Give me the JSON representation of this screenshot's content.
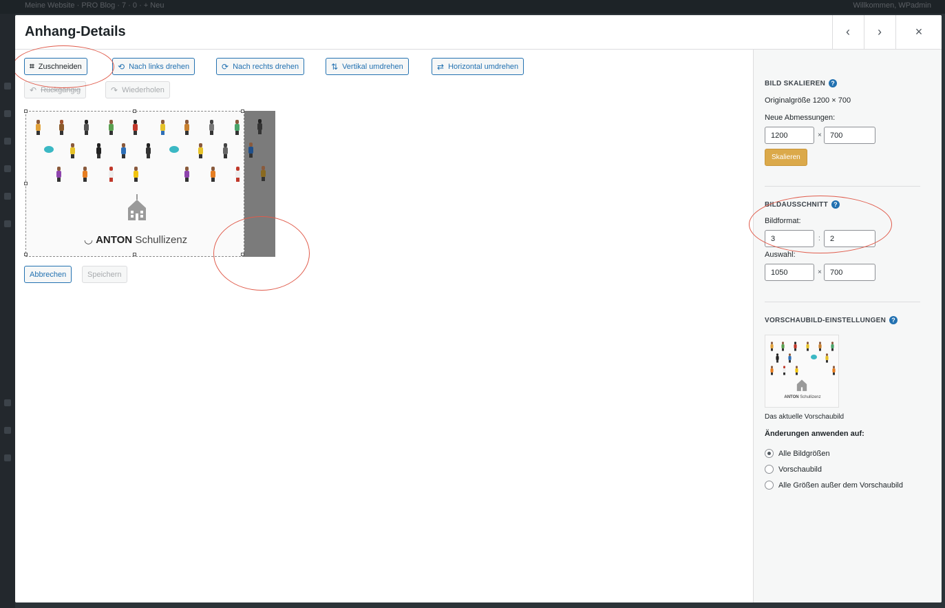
{
  "background": {
    "adminbar_left": "Meine Website  ·  PRO Blog  ·  7  ·  0  ·  + Neu",
    "adminbar_right": "Willkommen, WPadmin"
  },
  "modal": {
    "title": "Anhang-Details",
    "prev_icon": "‹",
    "next_icon": "›",
    "close_icon": "×"
  },
  "toolbar": {
    "crop_label": "Zuschneiden",
    "rotate_left_label": "Nach links drehen",
    "rotate_right_label": "Nach rechts drehen",
    "flip_vertical_label": "Vertikal umdrehen",
    "flip_horizontal_label": "Horizontal umdrehen",
    "undo_label": "Rückgängig",
    "redo_label": "Wiederholen"
  },
  "image": {
    "logo_brand": "ANTON",
    "logo_suffix": "Schullizenz"
  },
  "actions": {
    "cancel_label": "Abbrechen",
    "save_label": "Speichern"
  },
  "sidebar": {
    "scale": {
      "title": "BILD SKALIEREN",
      "original_size": "Originalgröße 1200 × 700",
      "new_dimensions_label": "Neue Abmessungen:",
      "width": "1200",
      "height": "700",
      "times": "×",
      "button_label": "Skalieren"
    },
    "crop": {
      "title": "BILDAUSSCHNITT",
      "aspect_label": "Bildformat:",
      "aspect_w": "3",
      "aspect_h": "2",
      "aspect_sep": ":",
      "selection_label": "Auswahl:",
      "sel_w": "1050",
      "sel_h": "700",
      "times": "×"
    },
    "thumbnail": {
      "title": "VORSCHAUBILD-EINSTELLUNGEN",
      "logo_brand": "ANTON",
      "logo_suffix": "Schullizenz",
      "current_caption": "Das aktuelle Vorschaubild",
      "apply_label": "Änderungen anwenden auf:",
      "options": [
        {
          "label": "Alle Bildgrößen",
          "checked": true
        },
        {
          "label": "Vorschaubild",
          "checked": false
        },
        {
          "label": "Alle Größen außer dem Vorschaubild",
          "checked": false
        }
      ]
    }
  },
  "colors": {
    "accent": "#2271b1",
    "annotation": "#e05b4b",
    "primary_button": "#dba94a"
  }
}
